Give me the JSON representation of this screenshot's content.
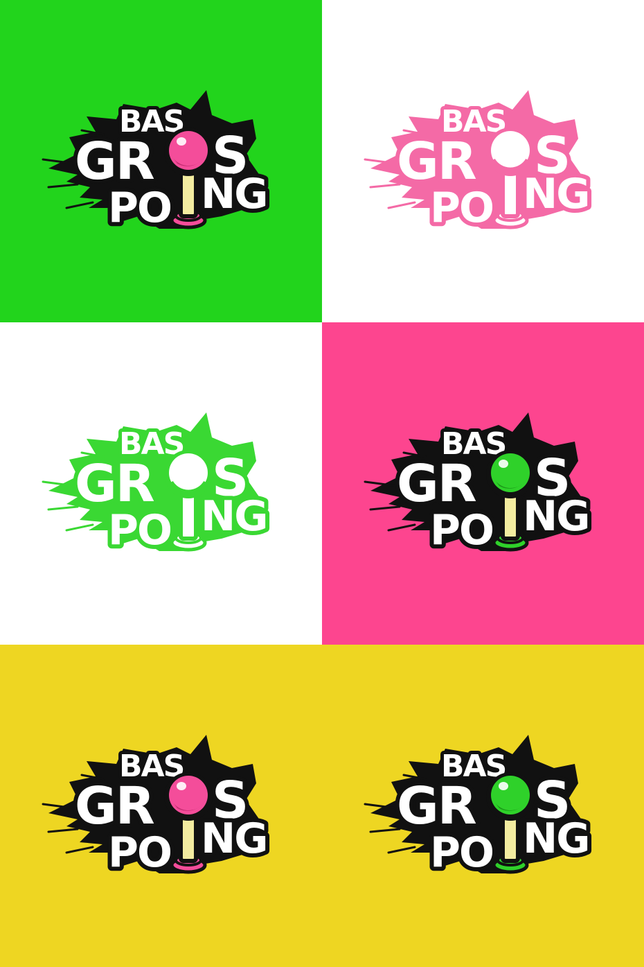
{
  "logo": {
    "line1": "BAS",
    "line2_left": "GR",
    "line2_right": "S",
    "line3_left": "PO",
    "line3_right": "NG"
  },
  "tiles": [
    {
      "name": "tile-green-bg-pink-ball",
      "background": "#22d41c",
      "style": "full",
      "letters": "#ffffff",
      "outline": "#111111",
      "ball": "#f44d9a",
      "ball_shade": "#c62e74",
      "stick": "#f3eca0",
      "base": "#f44d9a"
    },
    {
      "name": "tile-white-bg-pink-mono",
      "background": "#ffffff",
      "style": "mono",
      "letters": "#ffffff",
      "outline": "#f46aa6",
      "ball": "#ffffff",
      "ball_shade": "#f46aa6",
      "stick": "#ffffff",
      "base": "#f46aa6"
    },
    {
      "name": "tile-white-bg-green-mono",
      "background": "#ffffff",
      "style": "mono",
      "letters": "#ffffff",
      "outline": "#3ad833",
      "ball": "#ffffff",
      "ball_shade": "#3ad833",
      "stick": "#ffffff",
      "base": "#3ad833"
    },
    {
      "name": "tile-pink-bg-green-ball",
      "background": "#fd458f",
      "style": "full",
      "letters": "#ffffff",
      "outline": "#111111",
      "ball": "#2fd12a",
      "ball_shade": "#1a9a18",
      "stick": "#f3eca0",
      "base": "#2fd12a"
    },
    {
      "name": "tile-yellow-bg-pink-ball",
      "background": "#eed622",
      "style": "full",
      "letters": "#ffffff",
      "outline": "#111111",
      "ball": "#f44d9a",
      "ball_shade": "#c62e74",
      "stick": "#f3eca0",
      "base": "#f44d9a"
    },
    {
      "name": "tile-yellow-bg-green-ball",
      "background": "#eed622",
      "style": "full",
      "letters": "#ffffff",
      "outline": "#111111",
      "ball": "#2fd12a",
      "ball_shade": "#1a9a18",
      "stick": "#f3eca0",
      "base": "#2fd12a"
    }
  ]
}
